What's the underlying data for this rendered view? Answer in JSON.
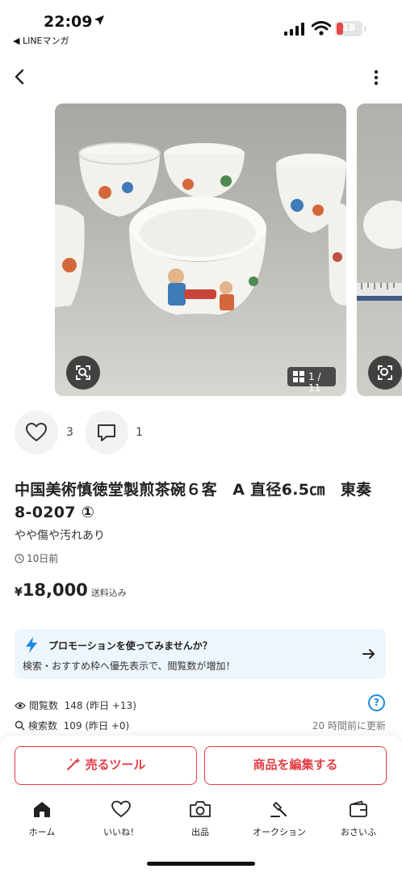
{
  "status_bar": {
    "time": "22:09",
    "back_app": "◀ LINEマンガ",
    "battery": "18"
  },
  "gallery": {
    "counter": "1 / 11"
  },
  "social": {
    "likes": "3",
    "comments": "1"
  },
  "item": {
    "title": "中国美術慎徳堂製煎茶碗６客　A 直径6.5㎝　東奏 8-0207 ①",
    "condition": "やや傷や汚れあり",
    "posted": "10日前",
    "price_symbol": "¥",
    "price": "18,000",
    "shipping": "送料込み"
  },
  "promo": {
    "title": "プロモーションを使ってみませんか？",
    "subtitle": "検索・おすすめ枠へ優先表示で、閲覧数が増加！"
  },
  "stats": {
    "views_label": "閲覧数",
    "views": "148 (昨日 +13)",
    "search_label": "検索数",
    "search": "109 (昨日 +0)",
    "updated": "20 時間前に更新",
    "help": "?"
  },
  "actions": {
    "sell_tool": "売るツール",
    "edit": "商品を編集する"
  },
  "tabs": [
    {
      "label": "ホーム",
      "icon": "home-icon"
    },
    {
      "label": "いいね！",
      "icon": "heart-icon"
    },
    {
      "label": "出品",
      "icon": "camera-icon"
    },
    {
      "label": "オークション",
      "icon": "gavel-icon"
    },
    {
      "label": "おさいふ",
      "icon": "wallet-icon"
    }
  ],
  "colors": {
    "accent_red": "#e23d43",
    "promo_blue": "#1a8ce3",
    "promo_bg": "#eef6fd"
  }
}
